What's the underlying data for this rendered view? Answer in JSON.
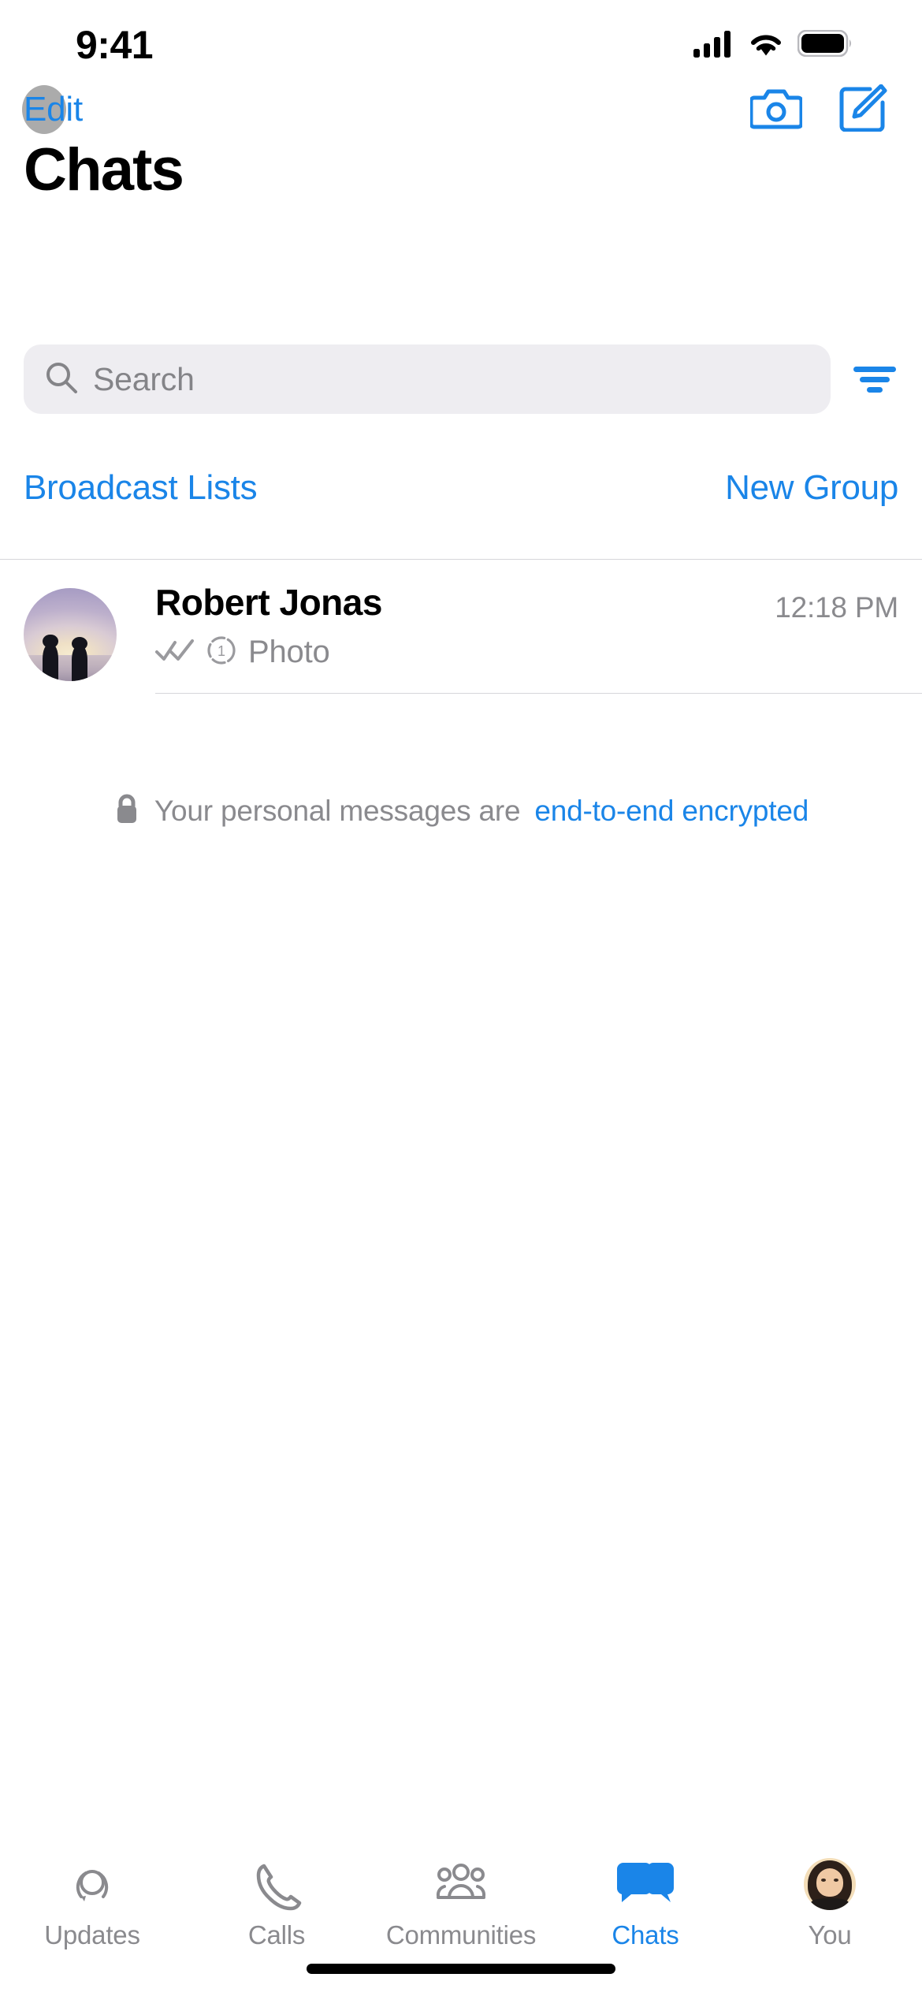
{
  "status_bar": {
    "time": "9:41",
    "icons": [
      "cellular-signal-icon",
      "wifi-icon",
      "battery-icon"
    ]
  },
  "nav_bar": {
    "edit_label": "Edit",
    "camera_icon": "camera-icon",
    "compose_icon": "compose-icon",
    "touch_indicator": true
  },
  "header": {
    "title": "Chats"
  },
  "search": {
    "placeholder": "Search",
    "value": "",
    "icon": "search-icon",
    "filter_icon": "filter-icon"
  },
  "quick_links": {
    "broadcast_label": "Broadcast Lists",
    "new_group_label": "New Group"
  },
  "chats": [
    {
      "name": "Robert Jonas",
      "time": "12:18 PM",
      "status_icon": "double-check-icon",
      "media_icon": "view-once-photo-icon",
      "preview": "Photo",
      "avatar": "sunset-silhouette-photo"
    }
  ],
  "encryption_notice": {
    "lock_icon": "lock-icon",
    "text": "Your personal messages are",
    "link_text": "end-to-end encrypted"
  },
  "tab_bar": {
    "active": "Chats",
    "items": [
      {
        "label": "Updates",
        "icon": "updates-status-icon"
      },
      {
        "label": "Calls",
        "icon": "phone-icon"
      },
      {
        "label": "Communities",
        "icon": "communities-icon"
      },
      {
        "label": "Chats",
        "icon": "chat-bubbles-icon"
      },
      {
        "label": "You",
        "icon": "profile-avatar-icon"
      }
    ]
  },
  "colors": {
    "accent": "#1a85e8",
    "secondary_text": "#8a8a8e",
    "search_background": "#eeedf1",
    "separator": "#d6d6da"
  }
}
